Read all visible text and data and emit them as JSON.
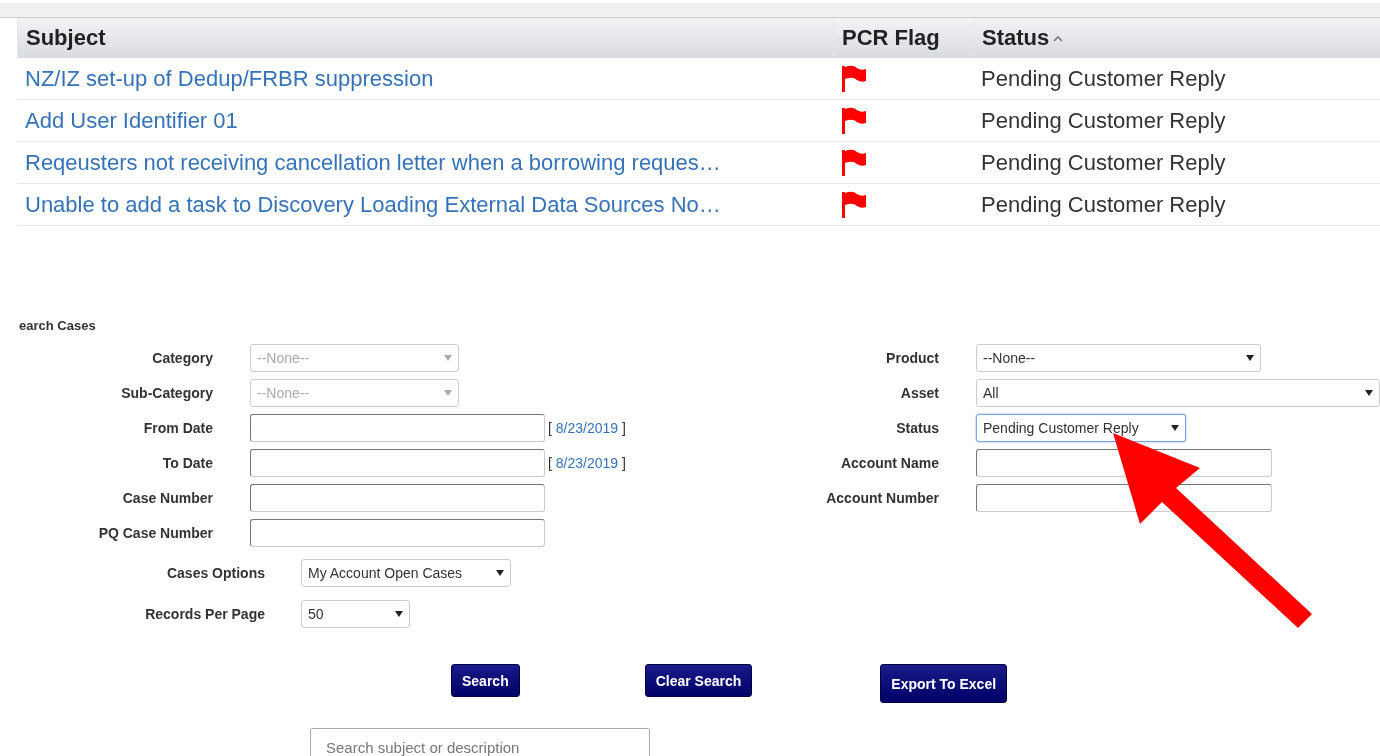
{
  "table": {
    "columns": [
      {
        "label": "Subject",
        "sorted": false
      },
      {
        "label": "PCR Flag",
        "sorted": false
      },
      {
        "label": "Status",
        "sorted": true
      }
    ],
    "rows": [
      {
        "subject": "NZ/IZ set-up of Dedup/FRBR suppression",
        "flagged": true,
        "status": "Pending Customer Reply"
      },
      {
        "subject": "Add User Identifier 01",
        "flagged": true,
        "status": "Pending Customer Reply"
      },
      {
        "subject": "Reqeusters not receiving cancellation letter when a borrowing reques…",
        "flagged": true,
        "status": "Pending Customer Reply"
      },
      {
        "subject": "Unable to add a task to Discovery Loading External Data Sources No…",
        "flagged": true,
        "status": "Pending Customer Reply"
      }
    ]
  },
  "search_form": {
    "title": "earch Cases",
    "left_fields": [
      {
        "label": "Category",
        "kind": "select",
        "value": "--None--",
        "disabled": true
      },
      {
        "label": "Sub-Category",
        "kind": "select",
        "value": "--None--",
        "disabled": true
      },
      {
        "label": "From Date",
        "kind": "date",
        "open": "[",
        "today": "8/23/2019",
        "close": "]"
      },
      {
        "label": "To Date",
        "kind": "date",
        "open": "[",
        "today": "8/23/2019",
        "close": "]"
      },
      {
        "label": "Case Number",
        "kind": "text"
      },
      {
        "label": "PQ Case Number",
        "kind": "text"
      }
    ],
    "right_fields": [
      {
        "label": "Product",
        "kind": "select",
        "value": "--None--",
        "focused": false
      },
      {
        "label": "Asset",
        "kind": "select",
        "value": "All",
        "focused": false
      },
      {
        "label": "Status",
        "kind": "select",
        "value": "Pending Customer Reply",
        "focused": true
      },
      {
        "label": "Account Name",
        "kind": "text"
      },
      {
        "label": "Account Number",
        "kind": "text"
      }
    ],
    "options": [
      {
        "label": "Cases Options",
        "value": "My Account Open Cases"
      },
      {
        "label": "Records Per Page",
        "value": "50"
      }
    ],
    "buttons": [
      "Search",
      "Clear Search",
      "Export To Excel"
    ],
    "search": {
      "placeholder": "Search subject or description"
    }
  },
  "annotation": {
    "kind": "arrow",
    "color": "#ff0000"
  }
}
